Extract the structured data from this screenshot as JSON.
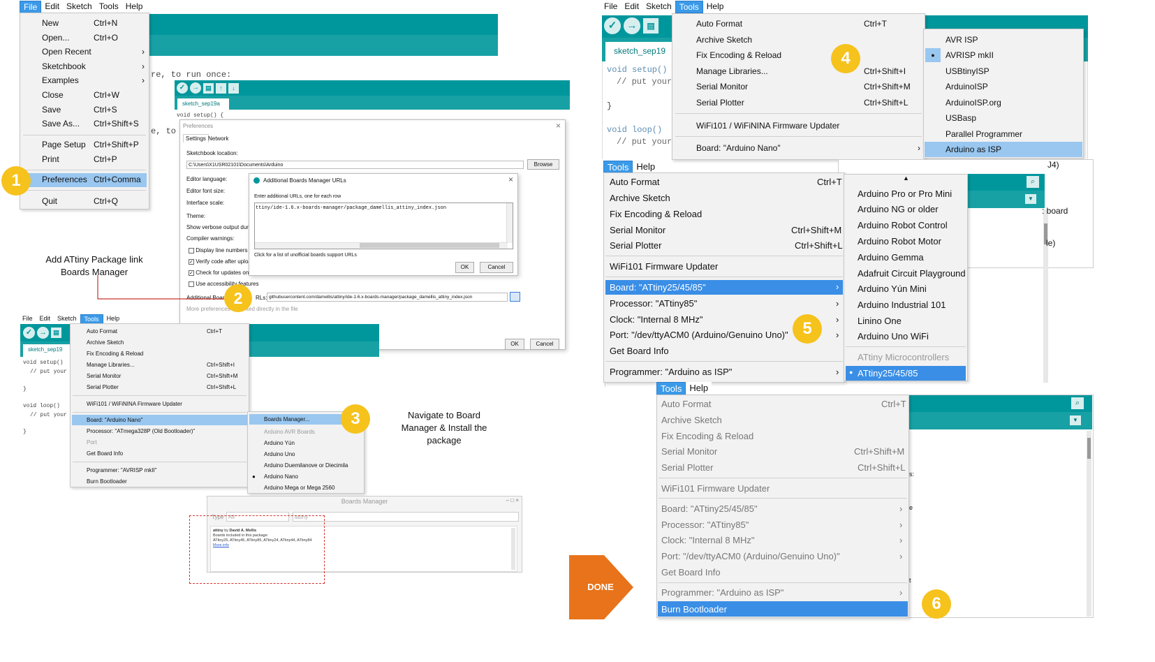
{
  "steps": {
    "s1": "1",
    "s2": "2",
    "s3": "3",
    "s4": "4",
    "s5": "5",
    "s6": "6"
  },
  "captions": {
    "step2": "Add ATtiny Package link Boards Manager",
    "step3": "Navigate to Board Manager & Install the package",
    "done": "DONE"
  },
  "menubar": {
    "file": "File",
    "edit": "Edit",
    "sketch": "Sketch",
    "tools": "Tools",
    "help": "Help"
  },
  "file_menu": {
    "new": "New",
    "new_k": "Ctrl+N",
    "open": "Open...",
    "open_k": "Ctrl+O",
    "open_recent": "Open Recent",
    "sketchbook": "Sketchbook",
    "examples": "Examples",
    "close": "Close",
    "close_k": "Ctrl+W",
    "save": "Save",
    "save_k": "Ctrl+S",
    "save_as": "Save As...",
    "save_as_k": "Ctrl+Shift+S",
    "page_setup": "Page Setup",
    "page_setup_k": "Ctrl+Shift+P",
    "print": "Print",
    "print_k": "Ctrl+P",
    "preferences": "Preferences",
    "preferences_k": "Ctrl+Comma",
    "quit": "Quit",
    "quit_k": "Ctrl+Q"
  },
  "code": {
    "setup_a": "re, to run once:",
    "comma": "e, to",
    "setup": "void setup() {",
    "setup_short": "void setup()",
    "put": "// put your",
    "close": "}",
    "loop": "void loop() {",
    "loop_short": "void loop()",
    "tab": "sketch_sep19a",
    "tab_short": "sketch_sep19",
    "put_a": "// put your",
    "board_frag": ": board",
    "le_frag": "le)",
    "j4": "J4)",
    "s_frag": "s:",
    "e_frag": "e",
    "t_frag": "t"
  },
  "prefs": {
    "title": "Preferences",
    "tab_settings": "Settings",
    "tab_network": "Network",
    "sketchbook_loc": "Sketchbook location:",
    "sketchbook_path": "C:\\Users\\X1USR02101\\Documents\\Arduino",
    "browse": "Browse",
    "editor_lang": "Editor language:",
    "font_size": "Editor font size:",
    "iface_scale": "Interface scale:",
    "theme": "Theme:",
    "verbose": "Show verbose output durin",
    "compiler_warn": "Compiler warnings:",
    "line_numbers": "Display line numbers",
    "verify": "Verify code after uploa",
    "check_updates": "Check for updates on s",
    "accessibility": "Use accessibility features",
    "add_boards": "Additional Boards",
    "add_boards_b": "RLs:",
    "url_value": "githubusercontent.com/damellis/attiny/ide-1.6.x-boards-manager/package_damellis_attiny_index.json",
    "more_prefs": "More preferences",
    "more_prefs_b": "ited directly in the file",
    "ok": "OK",
    "cancel": "Cancel"
  },
  "abm": {
    "title": "Additional Boards Manager URLs",
    "hint": "Enter additional URLs, one for each row",
    "url": "ttiny/ide-1.6.x-boards-manager/package_damellis_attiny_index.json",
    "link": "Click for a list of unofficial boards support URLs",
    "ok": "OK",
    "cancel": "Cancel"
  },
  "tools1": {
    "auto_format": "Auto Format",
    "auto_format_k": "Ctrl+T",
    "archive": "Archive Sketch",
    "fix_enc": "Fix Encoding & Reload",
    "manage_lib": "Manage Libraries...",
    "manage_lib_k": "Ctrl+Shift+I",
    "serial_mon": "Serial Monitor",
    "serial_mon_k": "Ctrl+Shift+M",
    "serial_plot": "Serial Plotter",
    "serial_plot_k": "Ctrl+Shift+L",
    "wifi": "WiFi101 / WiFiNINA Firmware Updater",
    "board": "Board: \"Arduino Nano\"",
    "processor": "Processor: \"ATmega328P (Old Bootloader)\"",
    "port": "Port",
    "get_info": "Get Board Info",
    "programmer": "Programmer: \"AVRISP mkII\"",
    "burn": "Burn Bootloader"
  },
  "boards_sub": {
    "manager": "Boards Manager...",
    "avr": "Arduino AVR Boards",
    "yun": "Arduino Yún",
    "uno": "Arduino Uno",
    "duem": "Arduino Duemilanove or Diecimila",
    "nano": "Arduino Nano",
    "mega": "Arduino Mega or Mega 2560"
  },
  "bm": {
    "title": "Boards Manager",
    "type": "Type",
    "all": "All",
    "filter": "attiny",
    "pkg": "attiny",
    "by": "by",
    "author": "David A. Mellis",
    "included": "Boards included in this package:",
    "boards": "ATtiny25, ATtiny45, ATtiny85, ATtiny24, ATtiny44, ATtiny84",
    "more": "More info"
  },
  "tools2": {
    "auto_format": "Auto Format",
    "auto_format_k": "Ctrl+T",
    "archive": "Archive Sketch",
    "fix_enc": "Fix Encoding & Reload",
    "manage_lib": "Manage Libraries...",
    "manage_lib_k": "Ctrl+Shift+I",
    "serial_mon": "Serial Monitor",
    "serial_mon_k": "Ctrl+Shift+M",
    "serial_plot": "Serial Plotter",
    "serial_plot_k": "Ctrl+Shift+L",
    "wifi": "WiFi101 / WiFiNINA Firmware Updater",
    "board": "Board: \"Arduino Nano\""
  },
  "prog_sub": {
    "avr_isp": "AVR ISP",
    "avrisp": "AVRISP mkII",
    "usbtiny": "USBtinyISP",
    "arduinoisp": "ArduinoISP",
    "arduinoisp_org": "ArduinoISP.org",
    "usbasp": "USBasp",
    "parallel": "Parallel Programmer",
    "as_isp": "Arduino as ISP"
  },
  "tools3": {
    "auto_format": "Auto Format",
    "auto_format_k": "Ctrl+T",
    "archive": "Archive Sketch",
    "fix_enc": "Fix Encoding & Reload",
    "serial_mon": "Serial Monitor",
    "serial_mon_k": "Ctrl+Shift+M",
    "serial_plot": "Serial Plotter",
    "serial_plot_k": "Ctrl+Shift+L",
    "wifi": "WiFi101 Firmware Updater",
    "board": "Board: \"ATtiny25/45/85\"",
    "processor": "Processor: \"ATtiny85\"",
    "clock": "Clock: \"Internal 8 MHz\"",
    "port": "Port: \"/dev/ttyACM0 (Arduino/Genuino Uno)\"",
    "get_info": "Get Board Info",
    "programmer": "Programmer: \"Arduino as ISP\"",
    "burn_frag": "Burn Bootloader"
  },
  "boards_sub2": {
    "pro_mini": "Arduino Pro or Pro Mini",
    "ng": "Arduino NG or older",
    "robot_ctrl": "Arduino Robot Control",
    "robot_motor": "Arduino Robot Motor",
    "gemma": "Arduino Gemma",
    "circuit": "Adafruit Circuit Playground",
    "yun_mini": "Arduino Yún Mini",
    "industrial": "Arduino Industrial 101",
    "linino": "Linino One",
    "uno_wifi": "Arduino Uno WiFi",
    "attiny_group": "ATtiny Microcontrollers",
    "attiny": "ATtiny25/45/85"
  },
  "tools4": {
    "auto_format": "Auto Format",
    "auto_format_k": "Ctrl+T",
    "archive": "Archive Sketch",
    "fix_enc": "Fix Encoding & Reload",
    "serial_mon": "Serial Monitor",
    "serial_mon_k": "Ctrl+Shift+M",
    "serial_plot": "Serial Plotter",
    "serial_plot_k": "Ctrl+Shift+L",
    "wifi": "WiFi101 Firmware Updater",
    "board": "Board: \"ATtiny25/45/85\"",
    "processor": "Processor: \"ATtiny85\"",
    "clock": "Clock: \"Internal 8 MHz\"",
    "port": "Port: \"/dev/ttyACM0 (Arduino/Genuino Uno)\"",
    "get_info": "Get Board Info",
    "programmer": "Programmer: \"Arduino as ISP\"",
    "burn": "Burn Bootloader"
  },
  "colors": {
    "teal": "#00979c",
    "highlight": "#3a8ee6",
    "badge": "#f6c21c",
    "done": "#e8731a"
  }
}
